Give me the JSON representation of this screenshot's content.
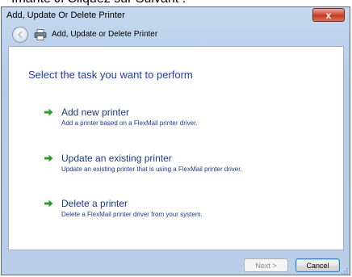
{
  "background_window": {
    "visible_text": "Imante Ji Cliquez sur Suivant ."
  },
  "window": {
    "title": "Add, Update Or Delete Printer",
    "close_label": "x"
  },
  "navbar": {
    "title": "Add, Update or Delete Printer",
    "back_icon": "back-arrow-icon",
    "app_icon": "printer-icon"
  },
  "main": {
    "heading": "Select the task you want to perform",
    "tasks": [
      {
        "title": "Add new printer",
        "description": "Add a printer based on a FlexMail printer driver.",
        "icon": "green-arrow-icon"
      },
      {
        "title": "Update an existing printer",
        "description": "Update an existing printer that is using a FlexMail printer driver.",
        "icon": "green-arrow-icon"
      },
      {
        "title": "Delete a printer",
        "description": "Delete a FlexMail printer driver from your system.",
        "icon": "green-arrow-icon"
      }
    ]
  },
  "footer": {
    "next_label": "Next >",
    "cancel_label": "Cancel",
    "next_enabled": false
  },
  "colors": {
    "heading": "#1f3ea8",
    "link": "#1b3a8c",
    "arrow": "#2e9e2b",
    "close_button": "#c43a21"
  }
}
